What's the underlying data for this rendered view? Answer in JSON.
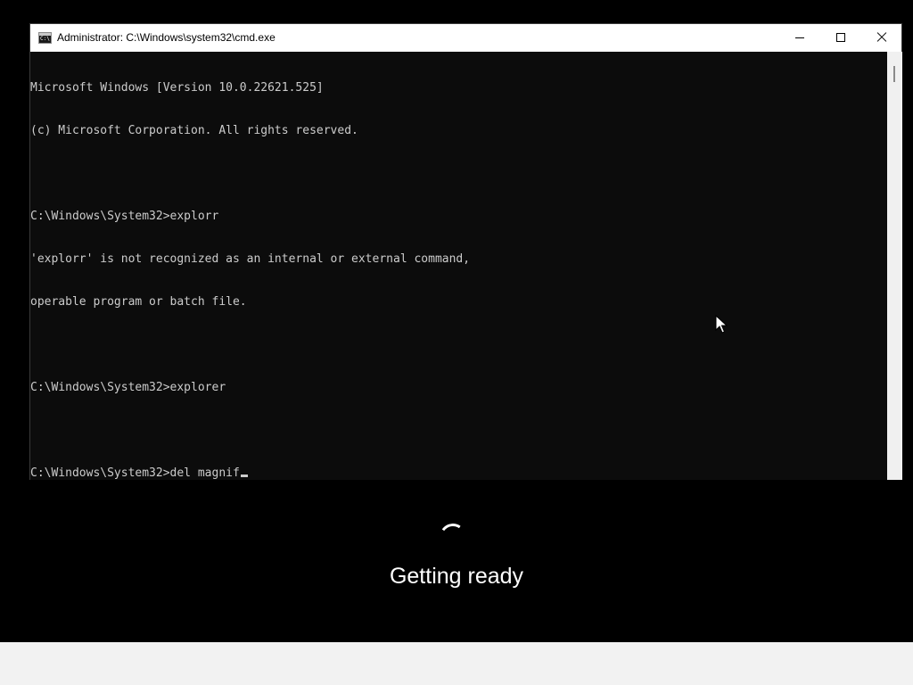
{
  "window": {
    "title": "Administrator: C:\\Windows\\system32\\cmd.exe",
    "icon": "cmd-icon",
    "controls": {
      "minimize_icon": "minimize-icon",
      "maximize_icon": "maximize-icon",
      "close_icon": "close-icon"
    }
  },
  "console": {
    "lines": [
      "Microsoft Windows [Version 10.0.22621.525]",
      "(c) Microsoft Corporation. All rights reserved.",
      "",
      "C:\\Windows\\System32>explorr",
      "'explorr' is not recognized as an internal or external command,",
      "operable program or batch file.",
      "",
      "C:\\Windows\\System32>explorer",
      ""
    ],
    "prompt_line": "C:\\Windows\\System32>del magnif"
  },
  "setup_screen": {
    "status": "Getting ready",
    "spinner_icon": "loading-spinner-icon"
  },
  "colors": {
    "desktop_background": "#000000",
    "console_background": "#0c0c0c",
    "console_text": "#cccccc",
    "titlebar": "#ffffff",
    "bottom_bar": "#f2f2f2"
  }
}
